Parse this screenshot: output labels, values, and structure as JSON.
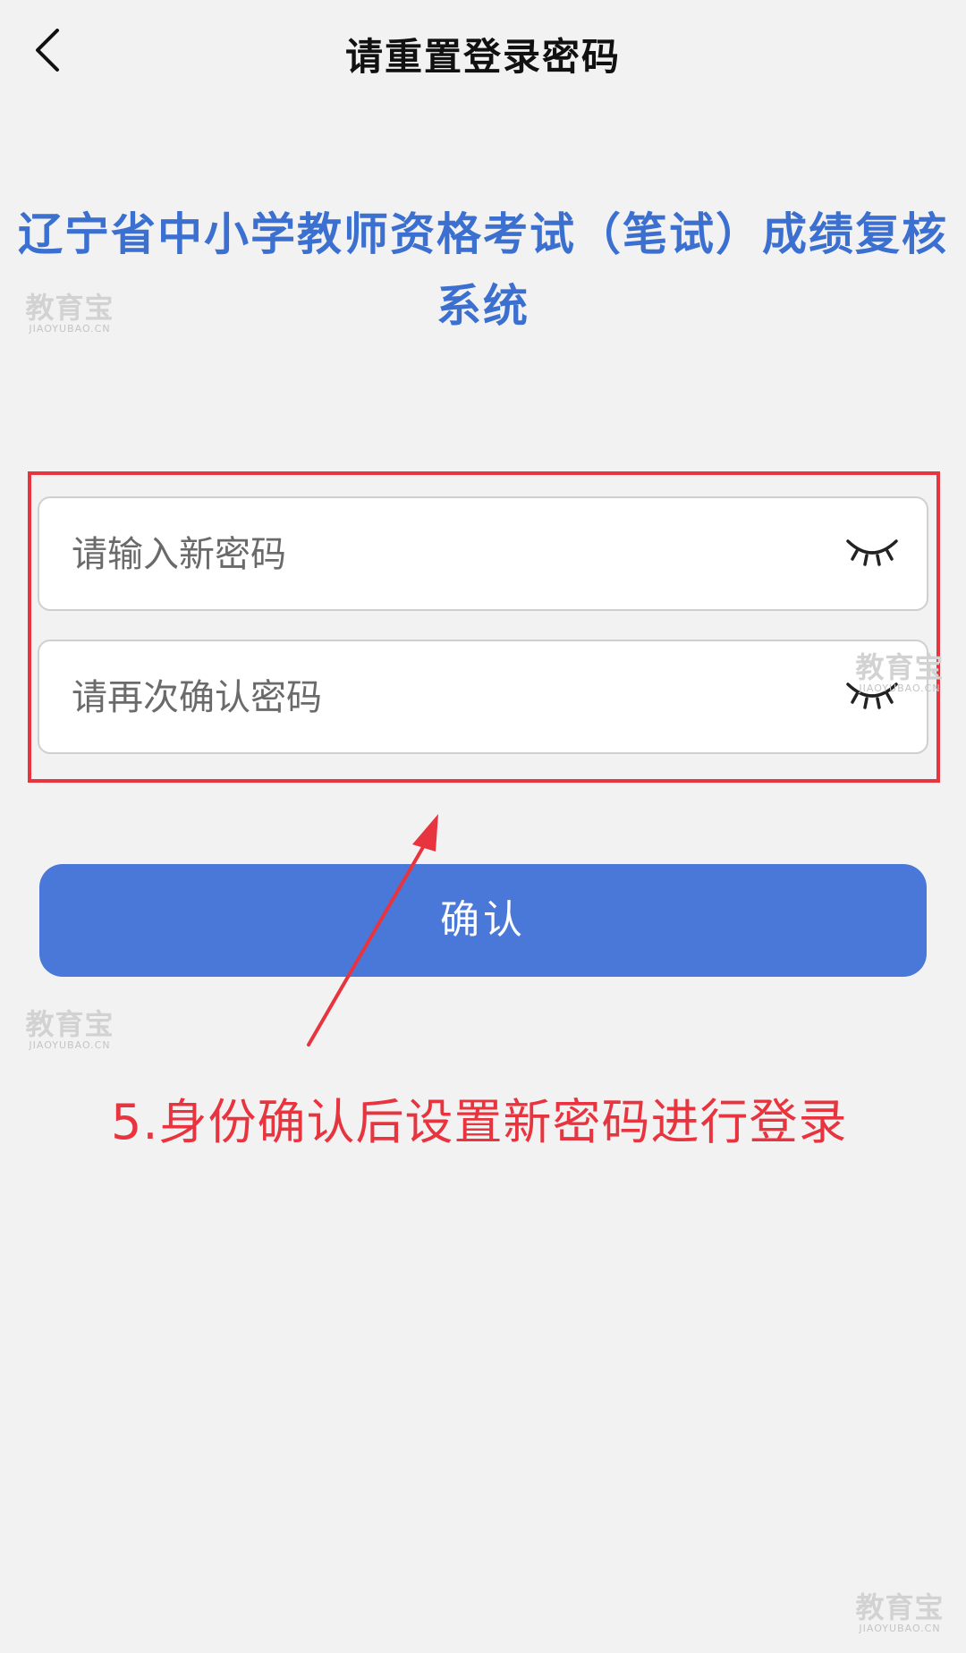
{
  "header": {
    "back_icon": "chevron-left-icon",
    "title": "请重置登录密码"
  },
  "system_title": "辽宁省中小学教师资格考试（笔试）成绩复核系统",
  "form": {
    "new_password_placeholder": "请输入新密码",
    "confirm_password_placeholder": "请再次确认密码",
    "toggle_icon": "eye-closed-icon"
  },
  "confirm_button_label": "确认",
  "annotation_text": "5.身份确认后设置新密码进行登录",
  "watermark": {
    "main": "教育宝",
    "sub": "JIAOYUBAO.CN"
  },
  "colors": {
    "accent": "#4a78d8",
    "title_blue": "#3b6fd0",
    "annotation_red": "#e8343e",
    "background": "#f2f2f2"
  }
}
